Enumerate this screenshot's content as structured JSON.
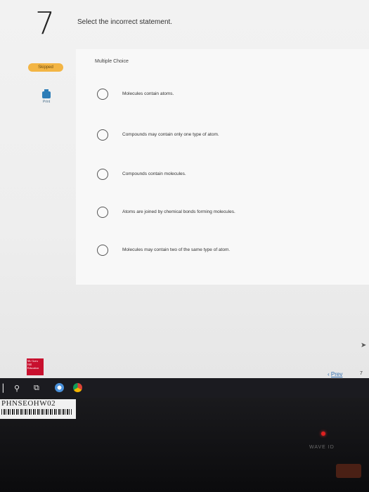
{
  "question": {
    "number": "7",
    "prompt": "Select the incorrect statement.",
    "status_badge": "Skipped",
    "type_label": "Multiple Choice"
  },
  "print": {
    "label": "Print",
    "icon": "printer-icon"
  },
  "options": [
    "Molecules contain atoms.",
    "Compounds may contain only one type of atom.",
    "Compounds contain molecules.",
    "Atoms are joined by chemical bonds forming molecules.",
    "Molecules may contain two of the same type of atom."
  ],
  "nav": {
    "prev_label": "Prev",
    "prev_icon": "chevron-left-icon",
    "page_number": "7"
  },
  "brand": {
    "logo_text": "Mc Graw Hill Education"
  },
  "taskbar": {
    "icons": [
      "windows-icon",
      "search-icon",
      "task-view-icon",
      "chrome-icon",
      "edge-icon"
    ]
  },
  "sticker": {
    "code": "PHNSEOHW02"
  },
  "device": {
    "label": "WAVE ID"
  },
  "colors": {
    "skipped_badge": "#f3b544",
    "link": "#2f6db0",
    "print_icon": "#2d7db7",
    "taskbar": "#1b1b20"
  }
}
